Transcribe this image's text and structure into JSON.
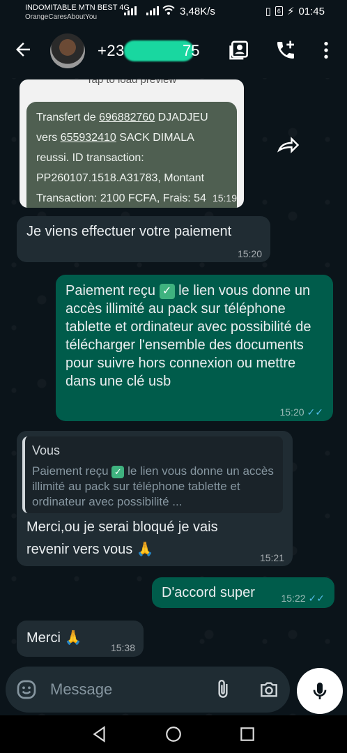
{
  "status_bar": {
    "carrier_line1": "INDOMITABLE MTN BEST 4G",
    "carrier_line2": "OrangeCaresAboutYou",
    "net_speed": "3,48K/s",
    "battery": "6",
    "time": "01:45"
  },
  "header": {
    "contact_prefix": "+23",
    "contact_suffix": "75"
  },
  "messages": {
    "forwarded": {
      "tap_label": "Tap to load preview",
      "line1_a": "Transfert de ",
      "line1_num": "696882760",
      "line1_b": " DJADJEU",
      "line2_a": "vers ",
      "line2_num": "655932410",
      "line2_b": " SACK DIMALA",
      "line3": "reussi. ID transaction:",
      "line4": "PP260107.1518.A31783, Montant",
      "line5": "Transaction: 2100 FCFA, Frais: 54",
      "time": "15:19"
    },
    "m1": {
      "text": "Je viens effectuer votre paiement",
      "time": "15:20"
    },
    "m2": {
      "text_a": "Paiement reçu ",
      "text_b": " le lien vous donne un accès illimité au pack sur téléphone tablette et ordinateur avec possibilité de télécharger l'ensemble des documents pour suivre hors connexion ou mettre dans une clé usb",
      "time": "15:20",
      "ticks": "✓✓"
    },
    "m3": {
      "quote_author": "Vous",
      "quote_a": "Paiement reçu ",
      "quote_b": " le lien vous donne un accès illimité au pack sur téléphone tablette et ordinateur avec possibilité ...",
      "text": "Merci,ou je serai bloqué je vais revenir vers vous",
      "time": "15:21"
    },
    "m4": {
      "text": "D'accord super",
      "time": "15:22",
      "ticks": "✓✓"
    },
    "m5": {
      "text": "Merci",
      "time": "15:38"
    }
  },
  "input": {
    "placeholder": "Message"
  },
  "colors": {
    "incoming": "#202c33",
    "outgoing": "#005c4b",
    "read_ticks": "#53bdeb"
  },
  "icons": [
    "back-arrow-icon",
    "video-call-icon",
    "add-call-icon",
    "more-options-icon",
    "forward-icon",
    "emoji-icon",
    "attach-icon",
    "camera-icon",
    "mic-icon"
  ]
}
